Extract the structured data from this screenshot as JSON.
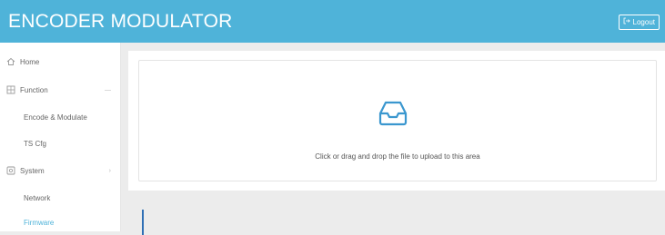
{
  "header": {
    "title": "ENCODER MODULATOR",
    "logout_label": "Logout"
  },
  "sidebar": {
    "items": [
      {
        "label": "Home",
        "icon": "home-icon"
      },
      {
        "label": "Function",
        "icon": "grid-icon"
      },
      {
        "label": "Encode & Modulate"
      },
      {
        "label": "TS Cfg"
      },
      {
        "label": "System",
        "icon": "settings-icon"
      },
      {
        "label": "Network"
      },
      {
        "label": "Firmware"
      }
    ]
  },
  "upload": {
    "icon": "inbox-icon",
    "text": "Click or drag and drop the file to upload to this area"
  },
  "colors": {
    "header": "#4fb3d9",
    "accent": "#4fb3d9",
    "active_marker": "#2f6fb5",
    "background": "#ececec"
  }
}
